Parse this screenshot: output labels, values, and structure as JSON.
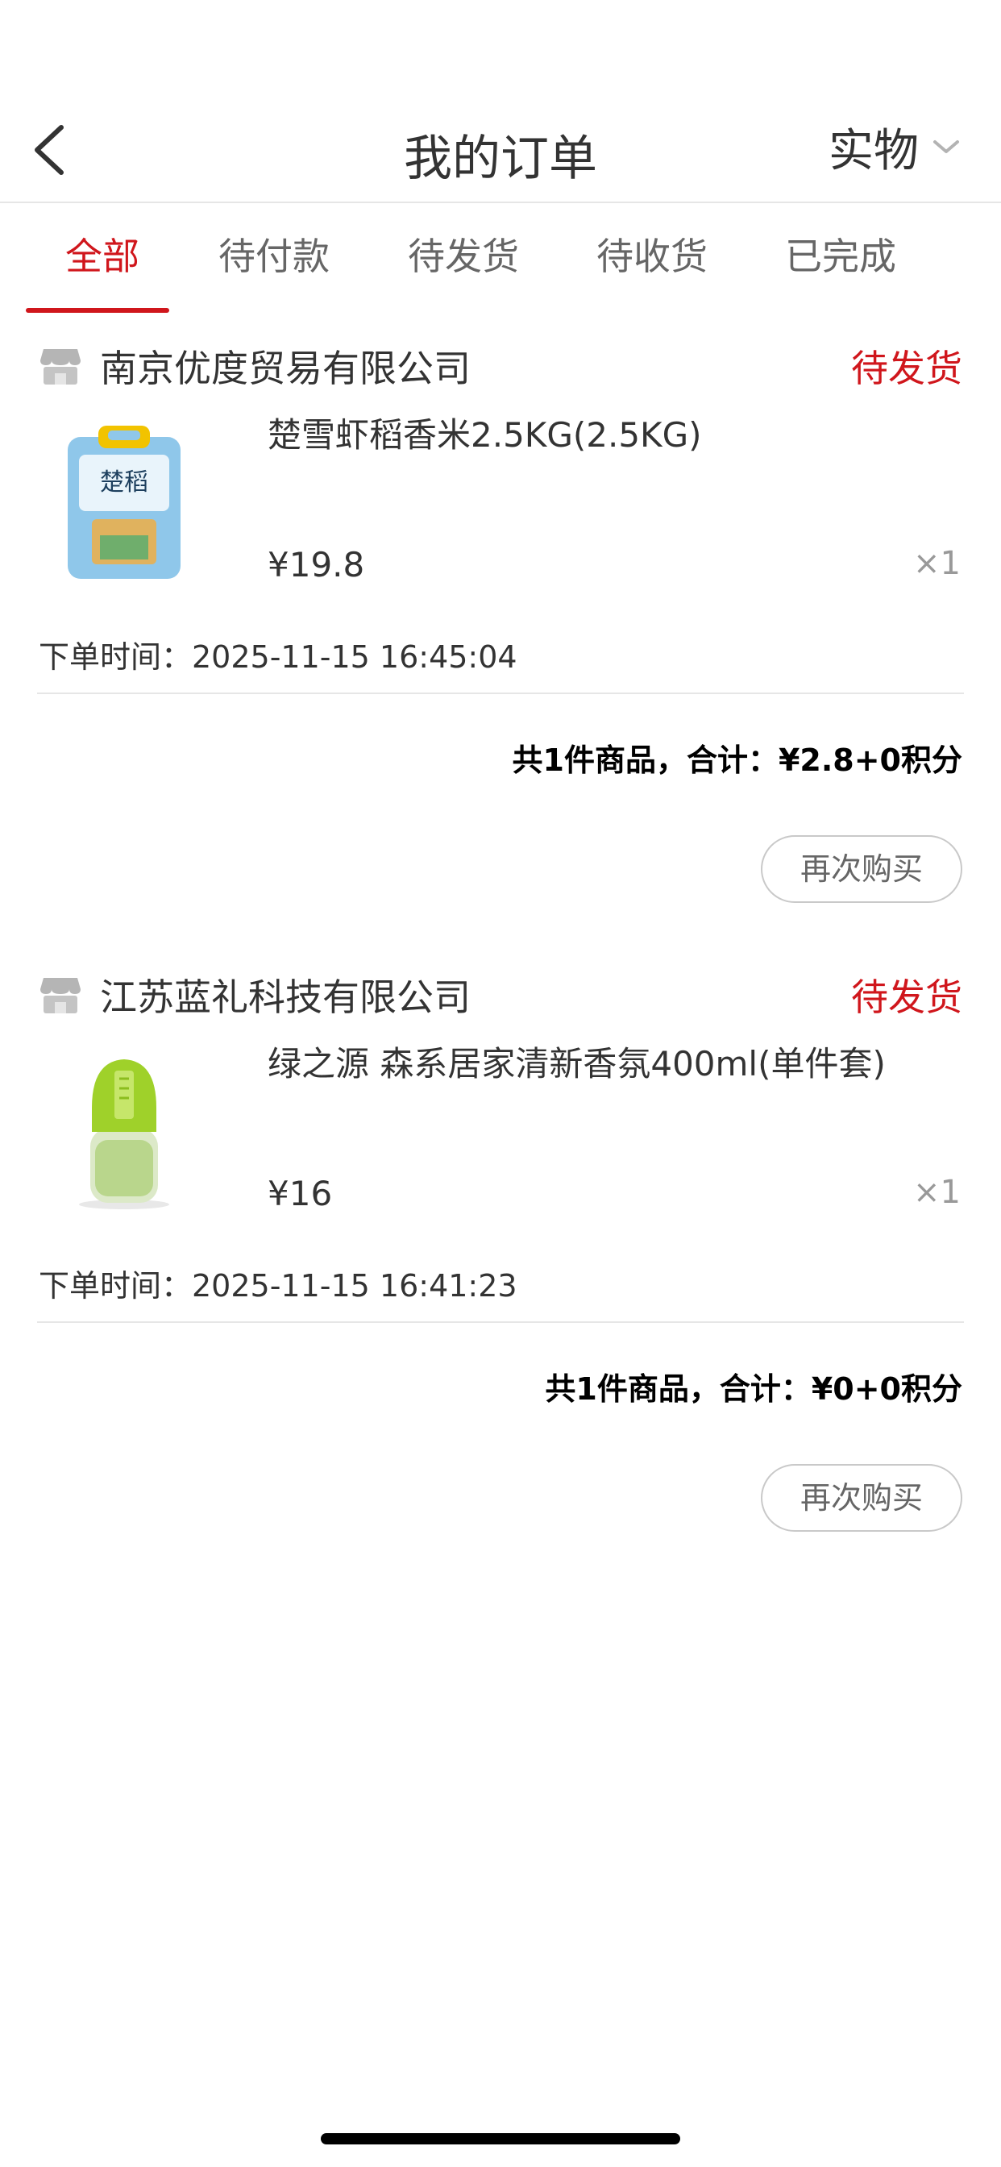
{
  "header": {
    "title": "我的订单",
    "filter_label": "实物"
  },
  "tabs": [
    {
      "label": "全部",
      "active": true
    },
    {
      "label": "待付款",
      "active": false
    },
    {
      "label": "待发货",
      "active": false
    },
    {
      "label": "待收货",
      "active": false
    },
    {
      "label": "已完成",
      "active": false
    }
  ],
  "orders": [
    {
      "store_name": "南京优度贸易有限公司",
      "status": "待发货",
      "product_name": "楚雪虾稻香米2.5KG(2.5KG)",
      "price": "¥19.8",
      "quantity": "×1",
      "order_time": "下单时间：2025-11-15 16:45:04",
      "summary": "共1件商品，合计：¥2.8+0积分",
      "rebuy_label": "再次购买"
    },
    {
      "store_name": "江苏蓝礼科技有限公司",
      "status": "待发货",
      "product_name": "绿之源 森系居家清新香氛400ml(单件套)",
      "price": "¥16",
      "quantity": "×1",
      "order_time": "下单时间：2025-11-15 16:41:23",
      "summary": "共1件商品，合计：¥0+0积分",
      "rebuy_label": "再次购买"
    }
  ],
  "colors": {
    "accent": "#d0161c",
    "divider": "#e6e6e6",
    "text": "#333333",
    "muted": "#999999"
  },
  "icons": {
    "back": "chevron-left-icon",
    "filter": "chevron-down-icon",
    "store": "store-icon"
  }
}
